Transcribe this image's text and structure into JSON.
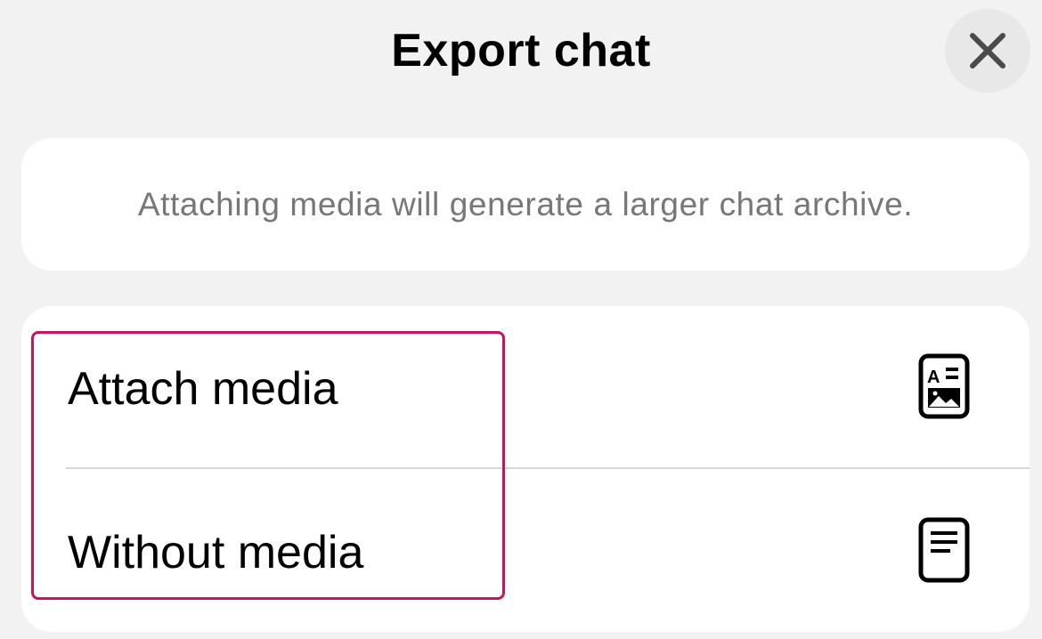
{
  "header": {
    "title": "Export chat"
  },
  "info": {
    "text": "Attaching media will generate a larger chat archive."
  },
  "options": [
    {
      "label": "Attach media",
      "icon": "media-document-icon"
    },
    {
      "label": "Without media",
      "icon": "text-document-icon"
    }
  ],
  "icons": {
    "close": "close-icon"
  },
  "colors": {
    "background": "#f2f2f2",
    "card": "#ffffff",
    "highlight": "#c2185b",
    "secondary_text": "#777777",
    "close_button_bg": "#e8e8e8"
  }
}
